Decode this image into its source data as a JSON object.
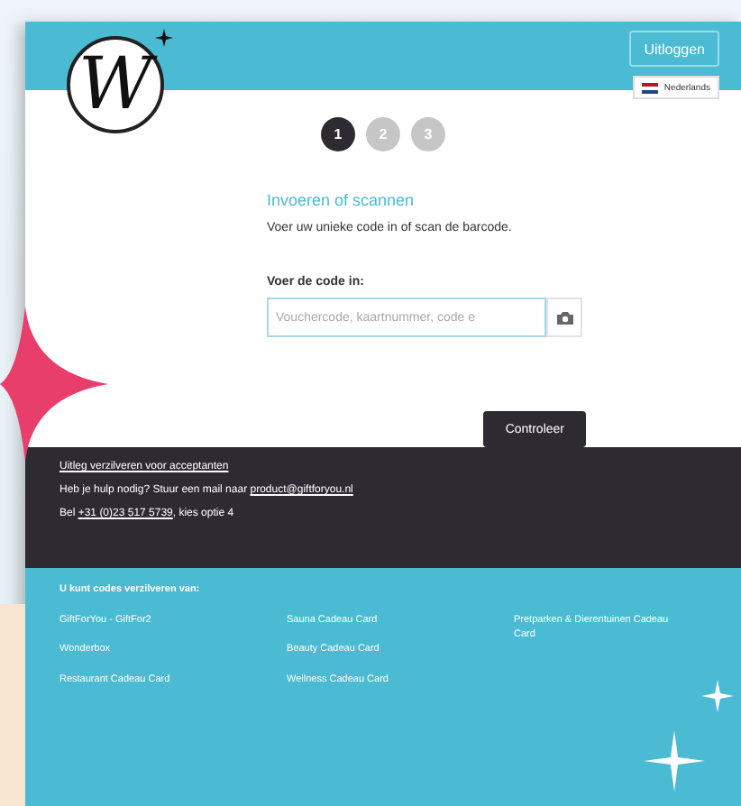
{
  "header": {
    "logo": "W",
    "logout_button": "Uitloggen",
    "language": "Nederlands"
  },
  "steps": [
    {
      "label": "1",
      "selected": true
    },
    {
      "label": "2",
      "selected": false
    },
    {
      "label": "3",
      "selected": false
    }
  ],
  "form": {
    "title": "Invoeren of scannen",
    "description": "Voer uw unieke code in of scan de barcode.",
    "field_label": "Voer de code in:",
    "placeholder": "Vouchercode, kaartnummer, code e",
    "submit_button": "Controleer"
  },
  "help": {
    "link": "Uitleg verzilveren voor acceptanten",
    "mail_text": "Heb je hulp nodig? Stuur een mail naar ",
    "mail_link": "product@giftforyou.nl",
    "phone_prefix": "Bel ",
    "phone_link": "+31 (0)23 517 5739",
    "phone_suffix": ", kies optie 4"
  },
  "partners": {
    "title": "U kunt codes verzilveren van:",
    "columns": [
      [
        "GiftForYou - GiftFor2",
        "Wonderbox",
        "Restaurant Cadeau Card"
      ],
      [
        "Sauna Cadeau Card",
        "Beauty Cadeau Card",
        "Wellness Cadeau Card"
      ],
      [
        "Pretparken & Dierentuinen Cadeau Card"
      ]
    ]
  }
}
